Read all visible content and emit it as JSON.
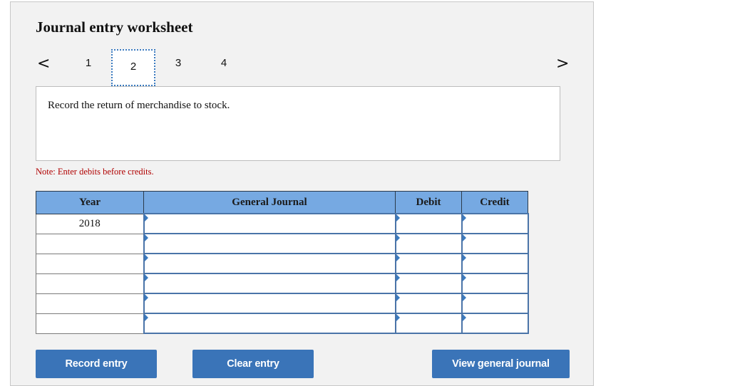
{
  "worksheet": {
    "title": "Journal entry worksheet",
    "nav": {
      "prev_icon": "chevron-left-icon",
      "prev_glyph": "<",
      "next_icon": "chevron-right-icon",
      "next_glyph": ">",
      "steps": [
        "1",
        "2",
        "3",
        "4"
      ],
      "active_step": "2"
    },
    "description": "Record the return of merchandise to stock.",
    "note": "Note: Enter debits before credits.",
    "colors": {
      "accent": "#3a74b8",
      "header_bg": "#76a9e2",
      "note": "#b00000"
    }
  },
  "table": {
    "headers": {
      "year": "Year",
      "general_journal": "General Journal",
      "debit": "Debit",
      "credit": "Credit"
    },
    "rows": [
      {
        "year": "2018",
        "account": "",
        "debit": "",
        "credit": ""
      },
      {
        "year": "",
        "account": "",
        "debit": "",
        "credit": ""
      },
      {
        "year": "",
        "account": "",
        "debit": "",
        "credit": ""
      },
      {
        "year": "",
        "account": "",
        "debit": "",
        "credit": ""
      },
      {
        "year": "",
        "account": "",
        "debit": "",
        "credit": ""
      },
      {
        "year": "",
        "account": "",
        "debit": "",
        "credit": ""
      }
    ]
  },
  "buttons": {
    "record": "Record entry",
    "clear": "Clear entry",
    "view": "View general journal"
  }
}
